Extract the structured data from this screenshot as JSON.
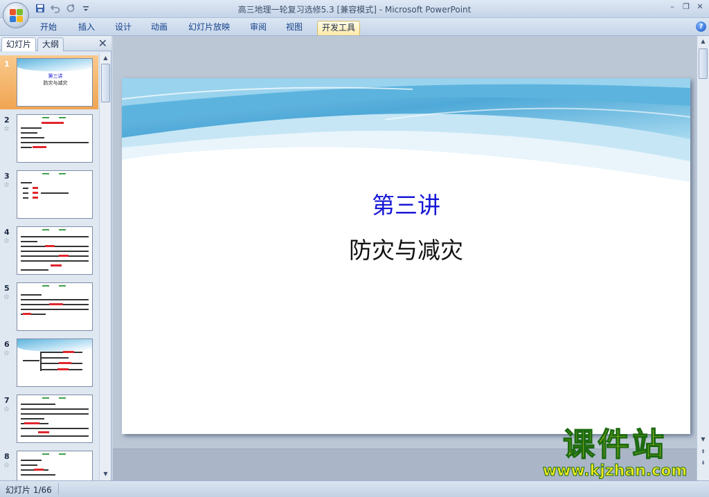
{
  "window": {
    "title": "高三地理一轮复习选修5.3 [兼容模式] - Microsoft PowerPoint",
    "controls": [
      "–",
      "❐",
      "✕"
    ]
  },
  "quick_access": {
    "icons": [
      "save-icon",
      "undo-icon",
      "redo-icon",
      "customize-icon"
    ]
  },
  "ribbon": {
    "tabs": [
      {
        "label": "开始"
      },
      {
        "label": "插入"
      },
      {
        "label": "设计"
      },
      {
        "label": "动画"
      },
      {
        "label": "幻灯片放映"
      },
      {
        "label": "审阅"
      },
      {
        "label": "视图"
      },
      {
        "label": "开发工具",
        "active": true
      }
    ],
    "help": "?"
  },
  "left_panel": {
    "tabs": [
      {
        "label": "幻灯片",
        "active": true
      },
      {
        "label": "大纲"
      }
    ],
    "close": "✕",
    "thumbnails": [
      {
        "number": "1",
        "selected": true,
        "title": "第三讲",
        "subtitle": "防灾与减灾"
      },
      {
        "number": "2"
      },
      {
        "number": "3"
      },
      {
        "number": "4"
      },
      {
        "number": "5"
      },
      {
        "number": "6"
      },
      {
        "number": "7"
      },
      {
        "number": "8"
      }
    ],
    "star_glyph": "☆"
  },
  "slide": {
    "title": "第三讲",
    "subtitle": "防灾与减灾",
    "title_color": "#1717d6"
  },
  "watermark": {
    "title": "课件站",
    "url": "www.kjzhan.com"
  },
  "status_bar": {
    "slide_indicator": "幻灯片 1/66"
  },
  "colors": {
    "accent": "#f0a552",
    "watermark_yellow": "#f4ec1d",
    "watermark_green": "#1d6b12"
  }
}
